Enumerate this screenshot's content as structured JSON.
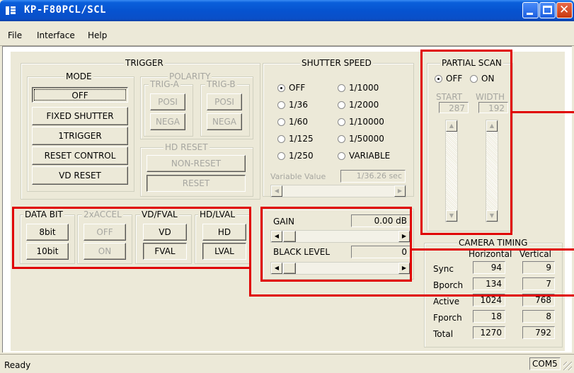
{
  "window": {
    "title": "KP-F80PCL/SCL"
  },
  "menu": [
    "File",
    "Interface",
    "Help"
  ],
  "trigger": {
    "title": "TRIGGER",
    "mode": {
      "title": "MODE",
      "buttons": [
        "OFF",
        "FIXED SHUTTER",
        "1TRIGGER",
        "RESET CONTROL",
        "VD RESET"
      ]
    },
    "polarity": {
      "title": "POLARITY",
      "trig_a": "TRIG-A",
      "trig_b": "TRIG-B",
      "posi": "POSI",
      "nega": "NEGA"
    },
    "hd_reset": {
      "title": "HD RESET",
      "non_reset": "NON-RESET",
      "reset": "RESET"
    }
  },
  "shutter": {
    "title": "SHUTTER SPEED",
    "options": [
      "OFF",
      "1/1000",
      "1/36",
      "1/2000",
      "1/60",
      "1/10000",
      "1/125",
      "1/50000",
      "1/250",
      "VARIABLE"
    ],
    "selected": "OFF",
    "variable_label": "Variable Value",
    "variable_value": "1/36.26 sec"
  },
  "partial": {
    "title": "PARTIAL SCAN",
    "off": "OFF",
    "on": "ON",
    "selected": "OFF",
    "start_label": "START",
    "width_label": "WIDTH",
    "start_value": "287",
    "width_value": "192"
  },
  "data_bit": {
    "title": "DATA BIT",
    "b8": "8bit",
    "b10": "10bit"
  },
  "accel": {
    "title": "2xACCEL",
    "off": "OFF",
    "on": "ON"
  },
  "vd_fval": {
    "title": "VD/FVAL",
    "vd": "VD",
    "fval": "FVAL"
  },
  "hd_lval": {
    "title": "HD/LVAL",
    "hd": "HD",
    "lval": "LVAL"
  },
  "gain": {
    "label": "GAIN",
    "value": "0.00 dB"
  },
  "black": {
    "label": "BLACK LEVEL",
    "value": "0"
  },
  "timing": {
    "title": "CAMERA TIMING",
    "col_h": "Horizontal",
    "col_v": "Vertical",
    "rows": [
      {
        "label": "Sync",
        "h": "94",
        "v": "9"
      },
      {
        "label": "Bporch",
        "h": "134",
        "v": "7"
      },
      {
        "label": "Active",
        "h": "1024",
        "v": "768"
      },
      {
        "label": "Fporch",
        "h": "18",
        "v": "8"
      },
      {
        "label": "Total",
        "h": "1270",
        "v": "792"
      }
    ]
  },
  "status": {
    "text": "Ready",
    "port": "COM5"
  },
  "colors": {
    "highlight": "#e00000",
    "titlebar": "#0653d0",
    "face": "#ece9d8"
  }
}
